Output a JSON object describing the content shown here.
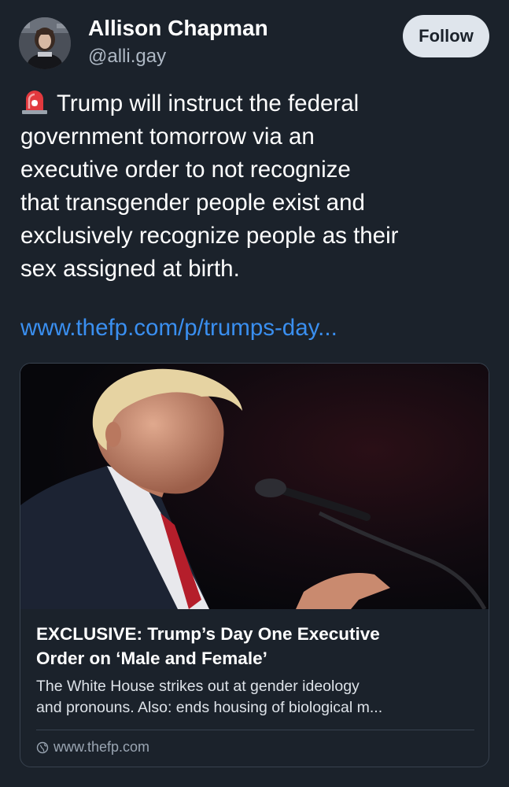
{
  "author": {
    "display_name": "Allison Chapman",
    "handle": "@alli.gay",
    "avatar_icon": "profile-photo-avatar"
  },
  "header": {
    "follow_label": "Follow"
  },
  "post": {
    "emoji_icon": "rotating-light-siren-icon",
    "text_lines": [
      "Trump will instruct the federal",
      "government tomorrow via an",
      "executive order to not recognize",
      "that transgender people exist and",
      "exclusively recognize people as their",
      "sex assigned at birth."
    ],
    "link_text": "www.thefp.com/p/trumps-day..."
  },
  "card": {
    "image_icon": "speaker-at-microphone-photo",
    "title_lines": [
      "EXCLUSIVE: Trump’s Day One Executive",
      "Order on ‘Male and Female’"
    ],
    "description_lines": [
      "The White House strikes out at gender ideology",
      "and pronouns. Also: ends housing of biological m..."
    ],
    "domain": "www.thefp.com",
    "domain_icon": "globe-icon"
  },
  "colors": {
    "background": "#1b222b",
    "link": "#3a8ff0",
    "follow_button_bg": "#dfe5ec",
    "secondary_text": "#aeb8c4",
    "card_border": "#38424f"
  }
}
